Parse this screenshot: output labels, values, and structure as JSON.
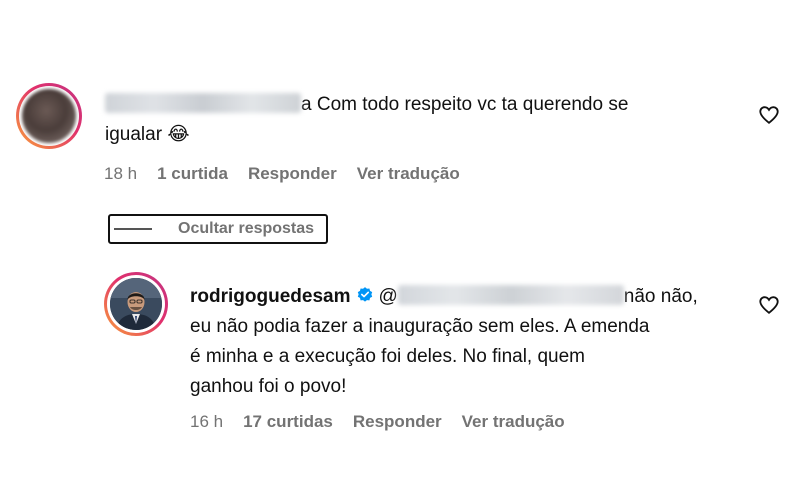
{
  "comment1": {
    "text_after_name": "a Com todo respeito vc ta querendo se",
    "text_line2": "igualar 😂",
    "meta": {
      "time": "18 h",
      "likes": "1 curtida",
      "reply": "Responder",
      "translate": "Ver tradução"
    }
  },
  "hide_replies": {
    "label": "Ocultar respostas"
  },
  "comment2": {
    "username": "rodrigoguedesam",
    "mention_prefix": "@",
    "line1_suffix": "não não,",
    "line2": "eu não podia fazer a inauguração sem eles. A emenda",
    "line3": "é minha e a execução foi deles. No final, quem",
    "line4": "ganhou foi o povo!",
    "meta": {
      "time": "16 h",
      "likes": "17 curtidas",
      "reply": "Responder",
      "translate": "Ver tradução"
    }
  },
  "icons": {
    "like": "heart-outline-icon",
    "verified": "verified-badge-icon",
    "accent_verified": "#0095f6",
    "accent_meta": "#737373"
  }
}
